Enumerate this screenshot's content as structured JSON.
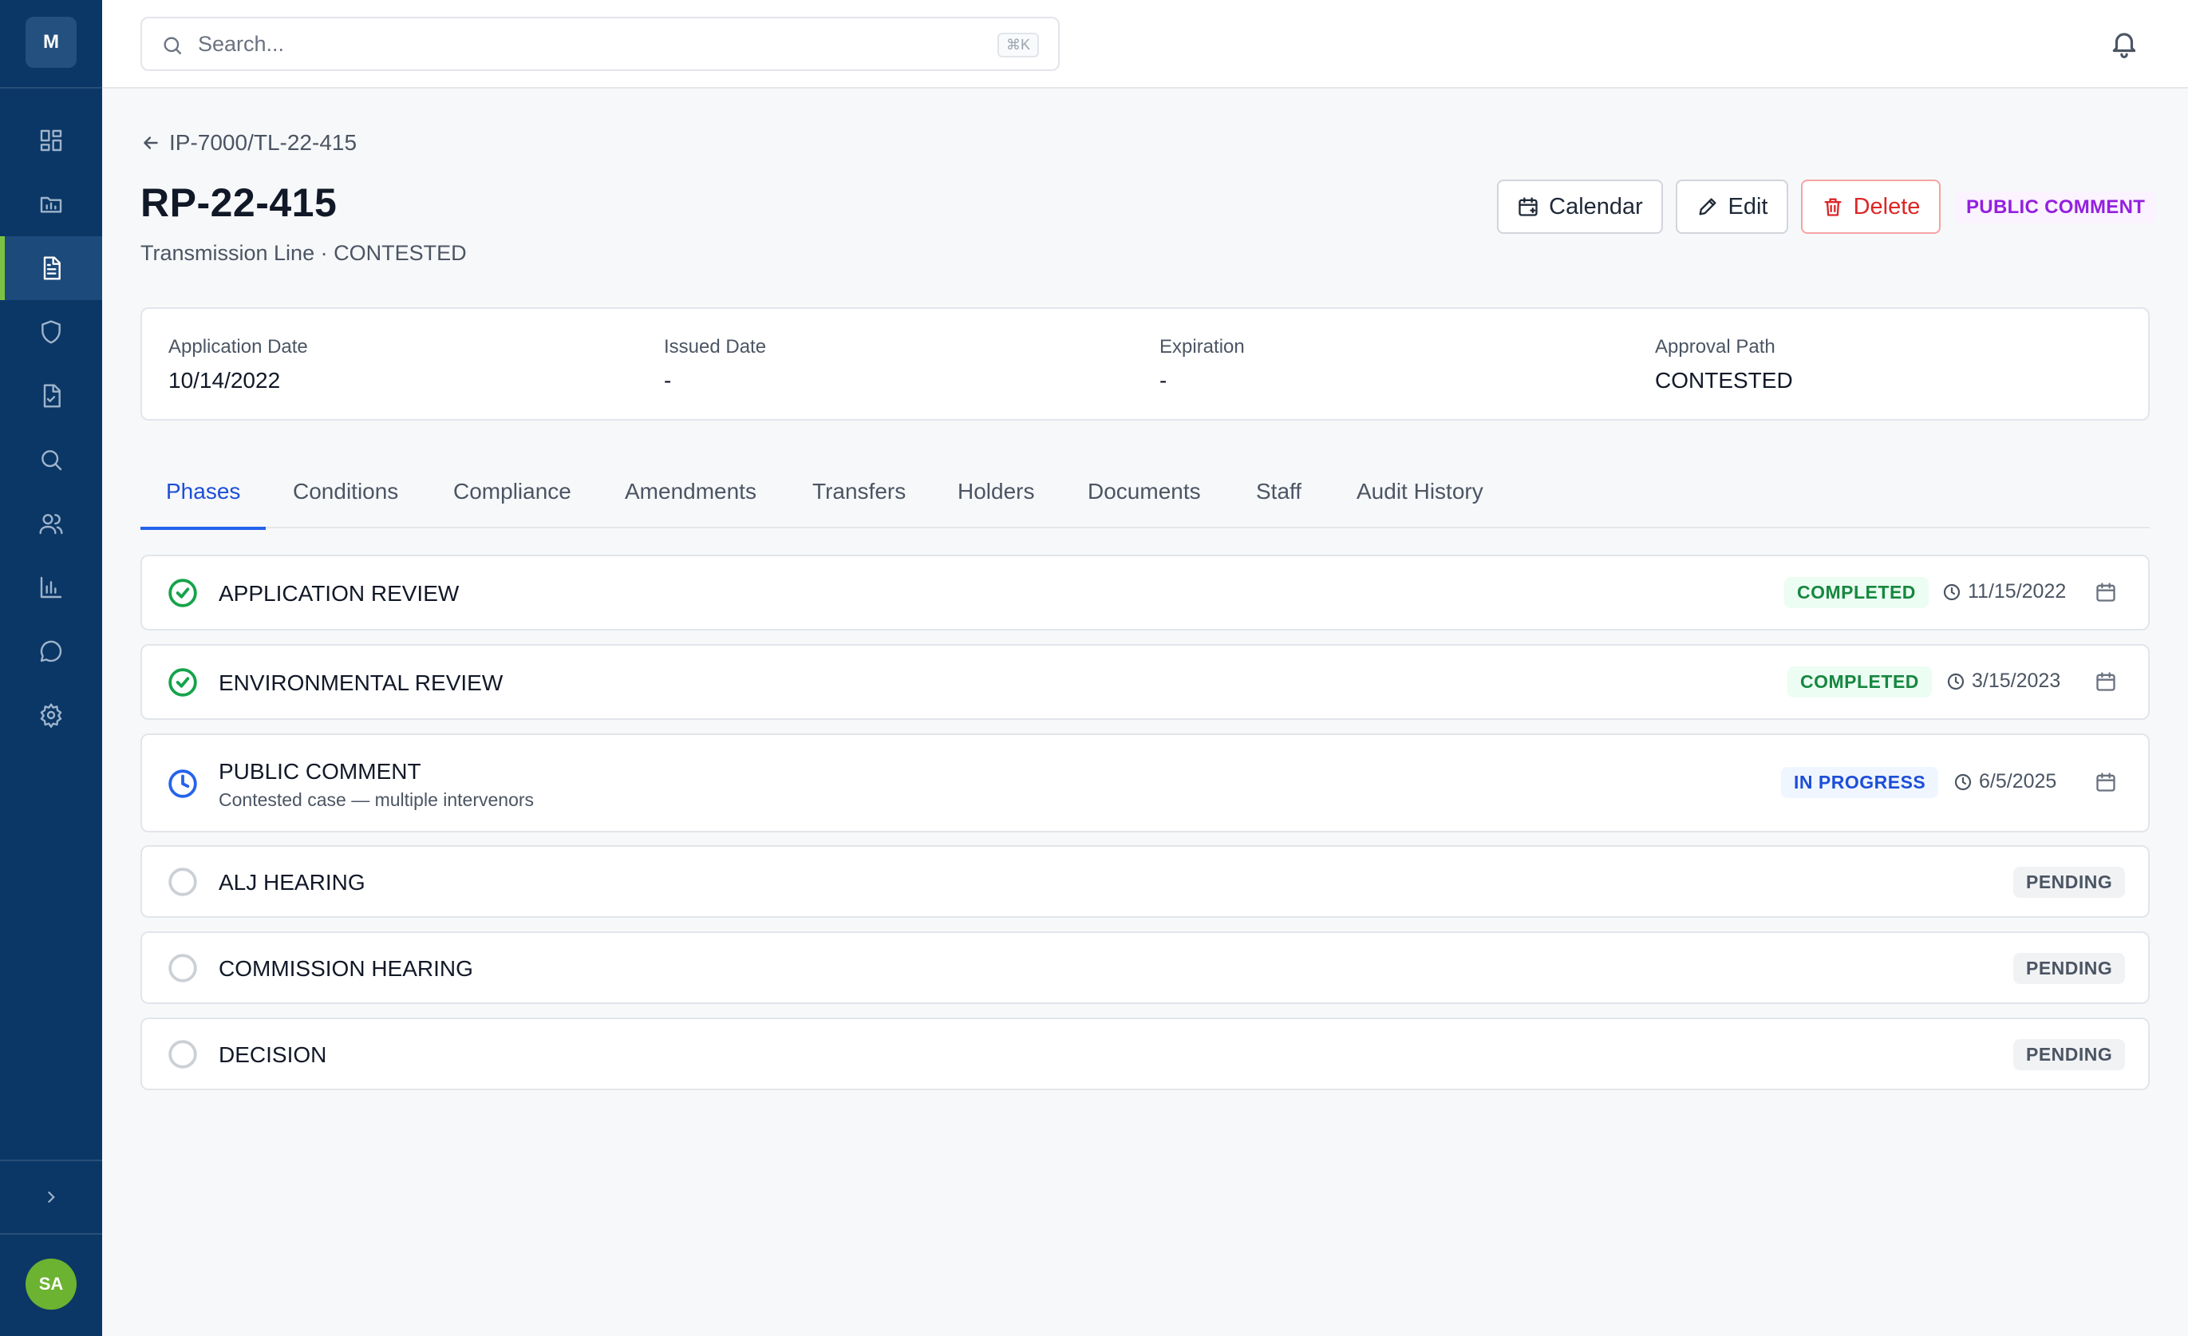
{
  "app": {
    "logo_letter": "M",
    "user_initials": "SA"
  },
  "sidebar": {
    "items": [
      {
        "name": "dashboard",
        "icon": "grid-icon"
      },
      {
        "name": "projects",
        "icon": "folder-icon"
      },
      {
        "name": "permits",
        "icon": "document-icon",
        "active": true
      },
      {
        "name": "security",
        "icon": "shield-icon"
      },
      {
        "name": "approvals",
        "icon": "file-check-icon"
      },
      {
        "name": "search",
        "icon": "search-icon"
      },
      {
        "name": "users",
        "icon": "users-icon"
      },
      {
        "name": "reports",
        "icon": "bar-chart-icon"
      },
      {
        "name": "messages",
        "icon": "chat-icon"
      },
      {
        "name": "settings",
        "icon": "gear-icon"
      }
    ]
  },
  "search": {
    "placeholder": "Search...",
    "shortcut": "⌘K"
  },
  "breadcrumb": {
    "label": "IP-7000/TL-22-415"
  },
  "header": {
    "title": "RP-22-415",
    "subtitle": "Transmission Line · CONTESTED",
    "status": "PUBLIC COMMENT",
    "status_color": "#9320e0"
  },
  "actions": {
    "calendar": "Calendar",
    "edit": "Edit",
    "delete": "Delete"
  },
  "info": {
    "application_date": {
      "label": "Application Date",
      "value": "10/14/2022"
    },
    "issued_date": {
      "label": "Issued Date",
      "value": "-"
    },
    "expiration": {
      "label": "Expiration",
      "value": "-"
    },
    "approval_path": {
      "label": "Approval Path",
      "value": "CONTESTED"
    }
  },
  "tabs": [
    "Phases",
    "Conditions",
    "Compliance",
    "Amendments",
    "Transfers",
    "Holders",
    "Documents",
    "Staff",
    "Audit History"
  ],
  "active_tab": "Phases",
  "phases": [
    {
      "name": "APPLICATION REVIEW",
      "status": "COMPLETED",
      "date": "11/15/2022",
      "icon": "check-circle-icon"
    },
    {
      "name": "ENVIRONMENTAL REVIEW",
      "status": "COMPLETED",
      "date": "3/15/2023",
      "icon": "check-circle-icon"
    },
    {
      "name": "PUBLIC COMMENT",
      "note": "Contested case — multiple intervenors",
      "status": "IN PROGRESS",
      "date": "6/5/2025",
      "icon": "clock-icon"
    },
    {
      "name": "ALJ HEARING",
      "status": "PENDING",
      "icon": "empty-circle-icon"
    },
    {
      "name": "COMMISSION HEARING",
      "status": "PENDING",
      "icon": "empty-circle-icon"
    },
    {
      "name": "DECISION",
      "status": "PENDING",
      "icon": "empty-circle-icon"
    }
  ],
  "colors": {
    "sidebar": "#0b3766",
    "accent": "#2563eb",
    "completed": "#16883f",
    "in_progress": "#1d4ed8",
    "danger": "#dc2626",
    "active_marker": "#7cc242"
  }
}
